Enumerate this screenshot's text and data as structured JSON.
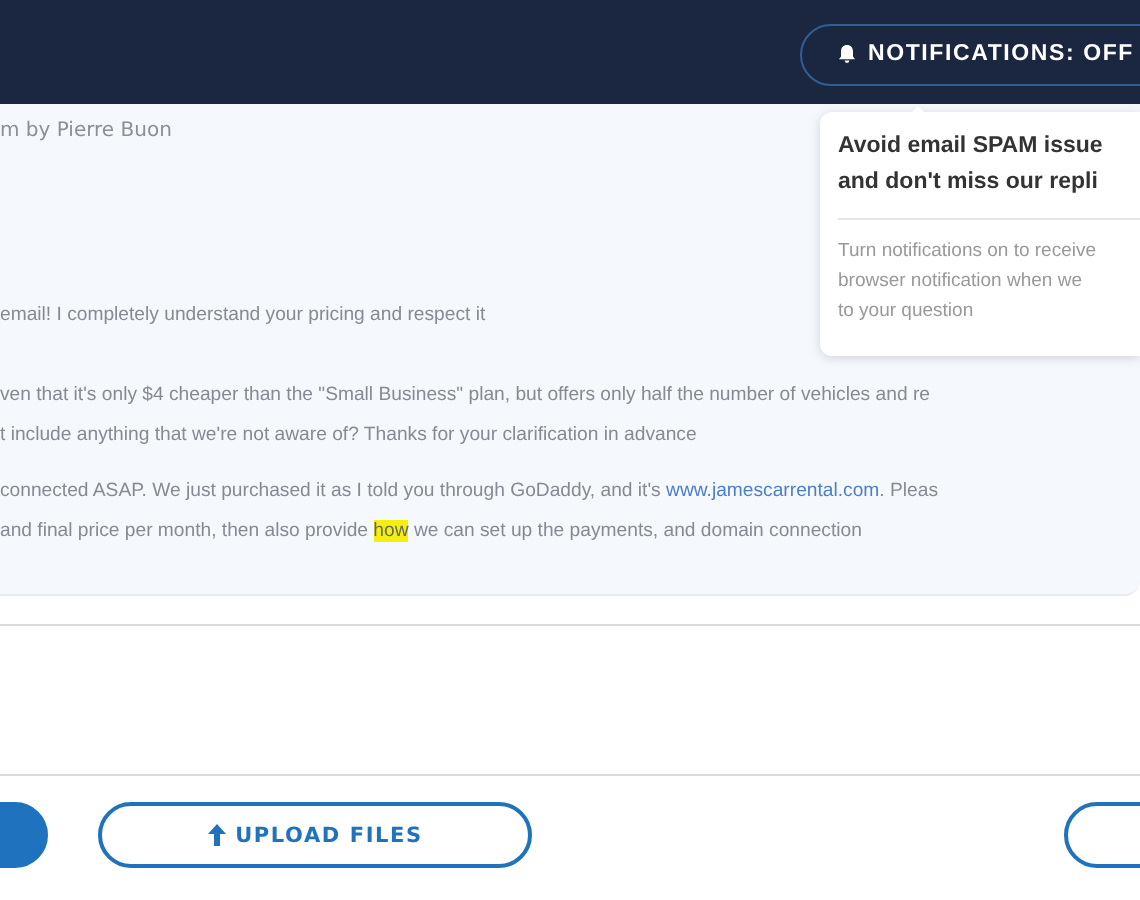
{
  "header": {
    "notifications_button": "NOTIFICATIONS: OFF"
  },
  "popup": {
    "title_lines": [
      "Avoid email SPAM issue",
      "and don't miss our repli"
    ],
    "body_lines": [
      "Turn notifications on to receive",
      "browser notification when we",
      "to your question"
    ]
  },
  "message": {
    "byline": "m by Pierre Buon",
    "paragraphs": [
      [
        {
          "kind": "text",
          "text": "email! I completely understand your pricing and respect it"
        }
      ],
      [
        {
          "kind": "text",
          "text": "ven that it's only $4 cheaper than the \"Small Business\" plan, but offers only half the number of vehicles and re"
        }
      ],
      [
        {
          "kind": "text",
          "text": "t include anything that we're not aware of? Thanks for your clarification in advance"
        }
      ],
      [
        {
          "kind": "text",
          "text": "connected ASAP. We just purchased it as I told you through GoDaddy, and it's "
        },
        {
          "kind": "link",
          "text": "www.jamescarrental.com"
        },
        {
          "kind": "text",
          "text": ". Pleas"
        }
      ],
      [
        {
          "kind": "text",
          "text": "and final price per month, then also provide "
        },
        {
          "kind": "highlight",
          "text": "how"
        },
        {
          "kind": "text",
          "text": " we can set up the payments, and domain connection"
        }
      ]
    ]
  },
  "buttons": [
    {
      "kind": "filled"
    },
    {
      "kind": "upload",
      "label": "UPLOAD FILES"
    },
    {
      "kind": "outline"
    }
  ]
}
